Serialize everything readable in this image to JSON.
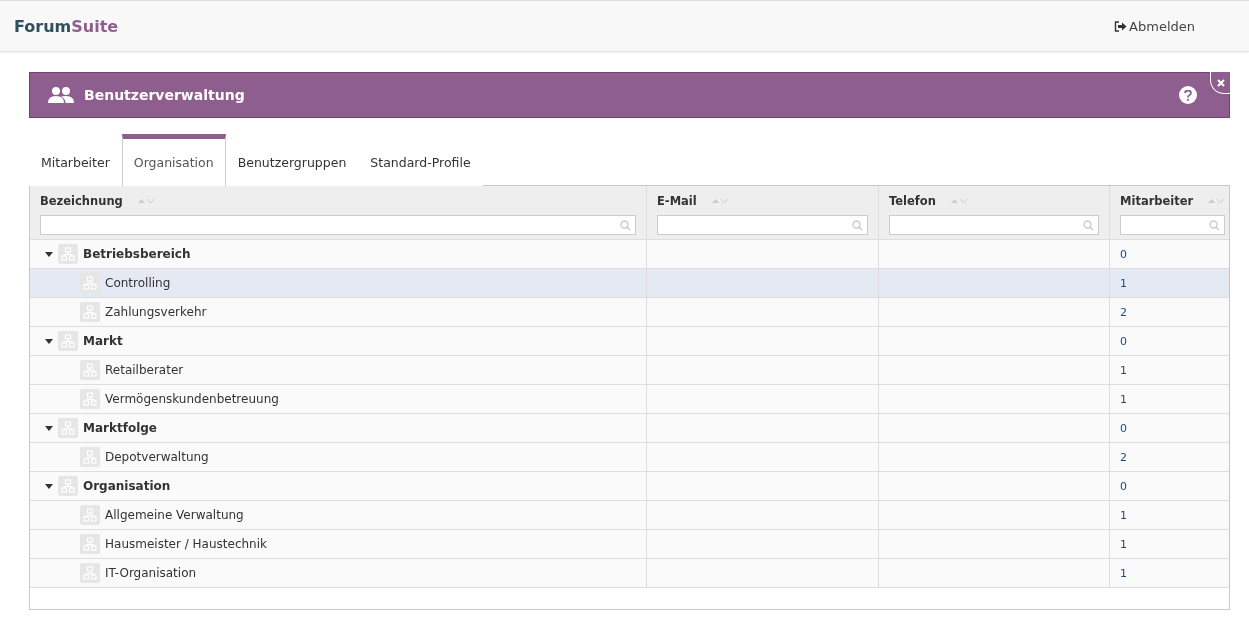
{
  "brand": {
    "first": "Forum",
    "second": "Suite"
  },
  "logout": {
    "label": "Abmelden"
  },
  "panel": {
    "title": "Benutzerverwaltung"
  },
  "tabs": [
    {
      "label": "Mitarbeiter",
      "selected": false
    },
    {
      "label": "Organisation",
      "selected": true
    },
    {
      "label": "Benutzergruppen",
      "selected": false
    },
    {
      "label": "Standard-Profile",
      "selected": false
    }
  ],
  "table": {
    "columns": [
      "Bezeichnung",
      "E-Mail",
      "Telefon",
      "Mitarbeiter"
    ],
    "rows": [
      {
        "name": "Betriebsbereich",
        "count": "0",
        "expanded": true,
        "selected": false,
        "children": [
          {
            "name": "Controlling",
            "count": "1",
            "selected": true
          },
          {
            "name": "Zahlungsverkehr",
            "count": "2",
            "selected": false
          }
        ]
      },
      {
        "name": "Markt",
        "count": "0",
        "expanded": true,
        "selected": false,
        "children": [
          {
            "name": "Retailberater",
            "count": "1",
            "selected": false
          },
          {
            "name": "Vermögenskundenbetreuung",
            "count": "1",
            "selected": false
          }
        ]
      },
      {
        "name": "Marktfolge",
        "count": "0",
        "expanded": true,
        "selected": false,
        "children": [
          {
            "name": "Depotverwaltung",
            "count": "2",
            "selected": false
          }
        ]
      },
      {
        "name": "Organisation",
        "count": "0",
        "expanded": true,
        "selected": false,
        "children": [
          {
            "name": "Allgemeine Verwaltung",
            "count": "1",
            "selected": false
          },
          {
            "name": "Hausmeister / Haustechnik",
            "count": "1",
            "selected": false
          },
          {
            "name": "IT-Organisation",
            "count": "1",
            "selected": false
          }
        ]
      }
    ]
  }
}
